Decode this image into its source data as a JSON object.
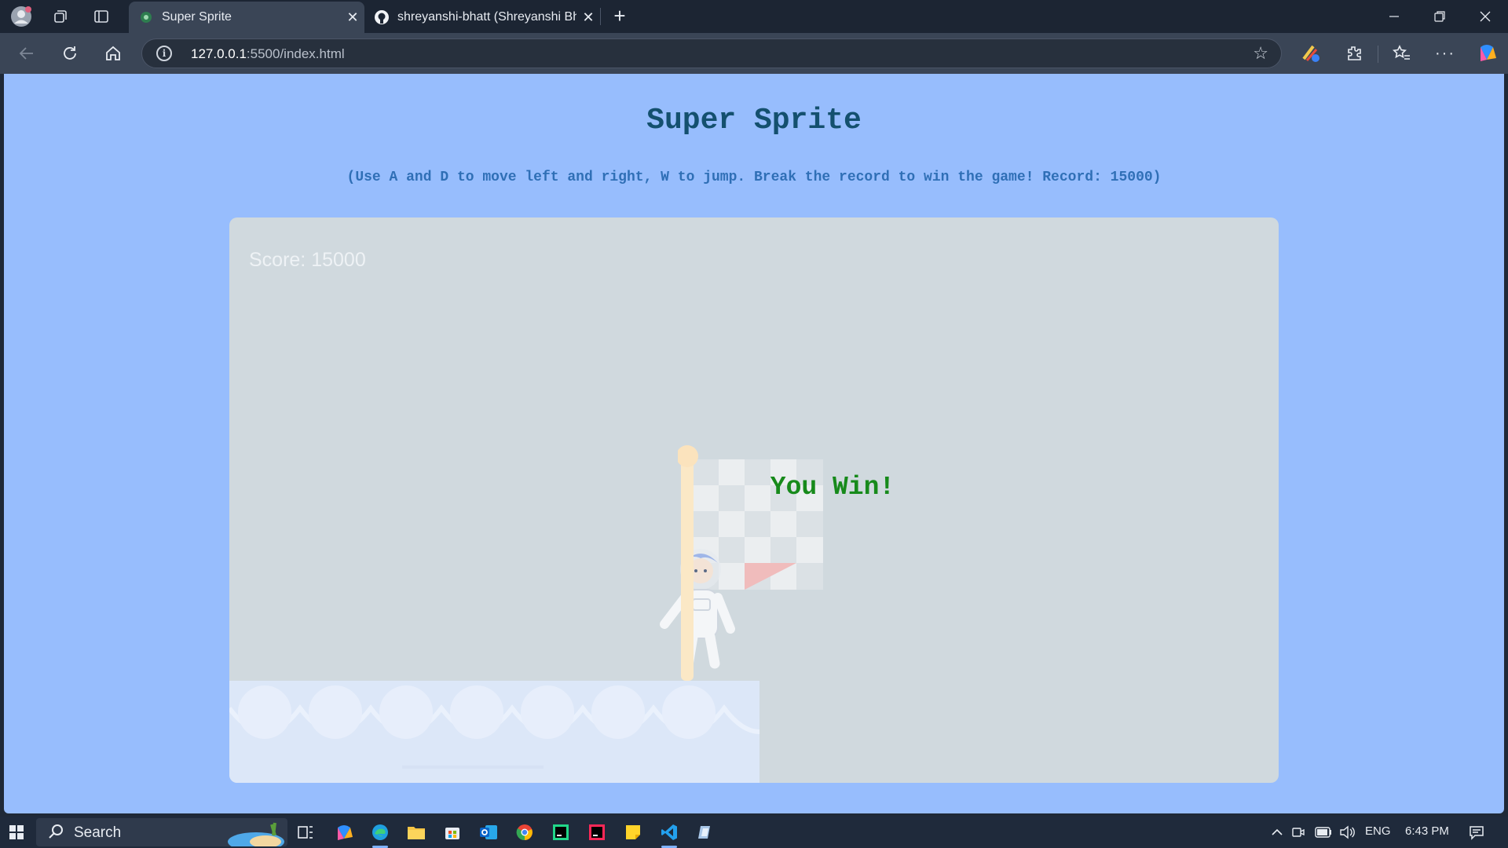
{
  "browser": {
    "tabs": [
      {
        "title": "Super Sprite",
        "active": true,
        "favicon": "sprite-favicon"
      },
      {
        "title": "shreyanshi-bhatt (Shreyanshi Bhatt)",
        "active": false,
        "favicon": "github-icon"
      }
    ],
    "url_host": "127.0.0.1",
    "url_rest": ":5500/index.html",
    "accent": "#3a4556"
  },
  "page": {
    "title": "Super Sprite",
    "instructions": "(Use A and D to move left and right, W to jump. Break the record to win the game! Record: 15000)",
    "background": "#97bdfd"
  },
  "game": {
    "score_text": "Score: 15000",
    "win_text": "You Win!",
    "win_color": "#178a1b"
  },
  "taskbar": {
    "search_label": "Search",
    "language": "ENG",
    "time": "6:43 PM"
  }
}
